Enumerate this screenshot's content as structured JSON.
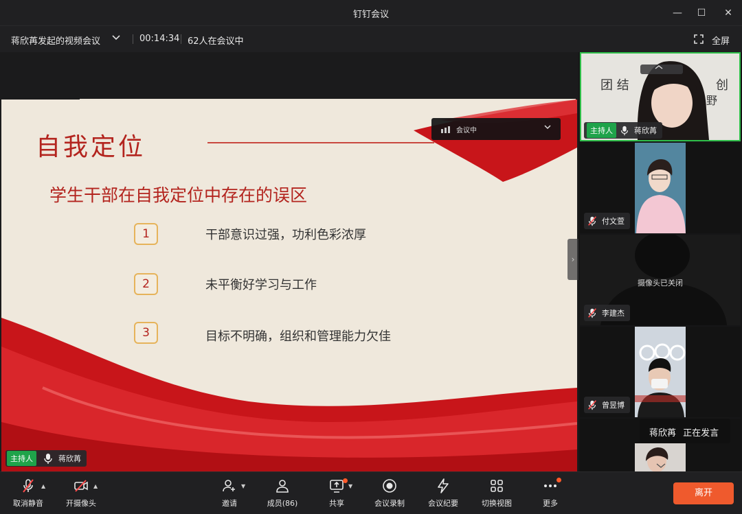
{
  "window": {
    "title": "钉钉会议",
    "minimize": "—",
    "maximize": "☐",
    "close": "✕"
  },
  "infobar": {
    "meeting_name": "蒋欣苒发起的视频会议",
    "duration": "00:14:34",
    "participants_in_meeting": "62人在会议中",
    "fullscreen_label": "全屏"
  },
  "slide": {
    "title": "自我定位",
    "subtitle": "学生干部在自我定位中存在的误区",
    "points": [
      {
        "num": "1",
        "text": "干部意识过强，功利色彩浓厚"
      },
      {
        "num": "2",
        "text": "未平衡好学习与工作"
      },
      {
        "num": "3",
        "text": "目标不明确，组织和管理能力欠佳"
      }
    ]
  },
  "status_dropdown": {
    "label": "会议中"
  },
  "stage_host_tag": {
    "role": "主持人",
    "name": "蒋欣苒"
  },
  "participants": [
    {
      "name": "蒋欣苒",
      "role": "主持人",
      "mic": "on",
      "active": true
    },
    {
      "name": "付文萱",
      "mic": "muted"
    },
    {
      "name": "李建杰",
      "mic": "muted",
      "camera_off_text": "摄像头已关闭"
    },
    {
      "name": "曾昱博",
      "mic": "muted"
    }
  ],
  "speaking_banner": {
    "name": "蒋欣苒",
    "status": "正在发言"
  },
  "toolbar": {
    "unmute": "取消静音",
    "camera": "开摄像头",
    "invite": "邀请",
    "members": "成员(86)",
    "share": "共享",
    "record": "会议录制",
    "minutes": "会议纪要",
    "switch_view": "切换视图",
    "more": "更多",
    "leave": "离开"
  },
  "colors": {
    "accent_green": "#1fa34a",
    "leave_orange": "#ef5a2d",
    "slide_red": "#b3241e",
    "notification_dot": "#ff5a2a"
  }
}
